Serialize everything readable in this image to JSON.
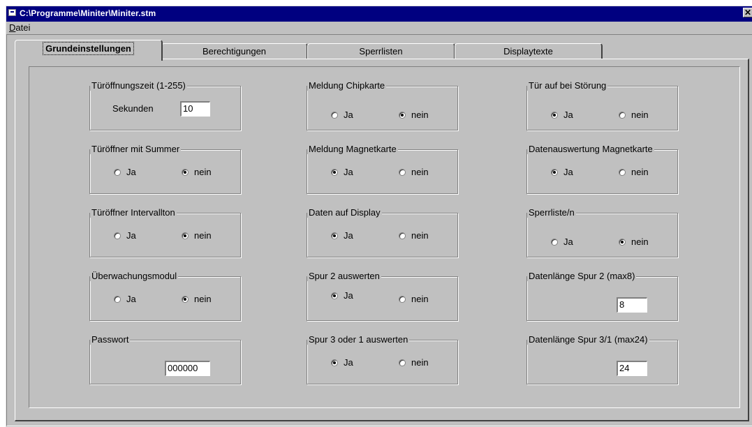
{
  "window": {
    "title": "C:\\Programme\\Miniter\\Miniter.stm",
    "close_glyph": "✕"
  },
  "menu": {
    "datei_first": "D",
    "datei_rest": "atei"
  },
  "tabs": [
    "Grundeinstellungen",
    "Berechtigungen",
    "Sperrlisten",
    "Displaytexte"
  ],
  "radio": {
    "yes": "Ja",
    "no": "nein"
  },
  "groups": {
    "tueroeffnungszeit": {
      "title": "Türöffnungszeit  (1-255)",
      "label": "Sekunden",
      "value": "10"
    },
    "meldung_chipkarte": {
      "title": "Meldung Chipkarte",
      "selected": "nein"
    },
    "tuer_auf_stoerung": {
      "title": "Tür auf bei Störung",
      "selected": "Ja"
    },
    "tueroeffner_summer": {
      "title": "Türöffner mit Summer",
      "selected": "nein"
    },
    "meldung_magnetkarte": {
      "title": "Meldung Magnetkarte",
      "selected": "Ja"
    },
    "datenauswertung_magnetkarte": {
      "title": "Datenauswertung Magnetkarte",
      "selected": "Ja"
    },
    "tueroeffner_intervallton": {
      "title": "Türöffner Intervallton",
      "selected": "nein"
    },
    "daten_auf_display": {
      "title": "Daten auf Display",
      "selected": "Ja"
    },
    "sperrliste": {
      "title": "Sperrliste/n",
      "selected": "nein"
    },
    "ueberwachungsmodul": {
      "title": "Überwachungsmodul",
      "selected": "nein"
    },
    "spur2_auswerten": {
      "title": "Spur 2 auswerten",
      "selected": "Ja"
    },
    "datenlaenge_spur2": {
      "title": "Datenlänge Spur 2  (max8)",
      "value": "8"
    },
    "passwort": {
      "title": "Passwort",
      "value": "000000"
    },
    "spur3_1_auswerten": {
      "title": "Spur 3 oder 1 auswerten",
      "selected": "Ja"
    },
    "datenlaenge_spur3_1": {
      "title": "Datenlänge Spur 3/1  (max24)",
      "value": "24"
    }
  }
}
